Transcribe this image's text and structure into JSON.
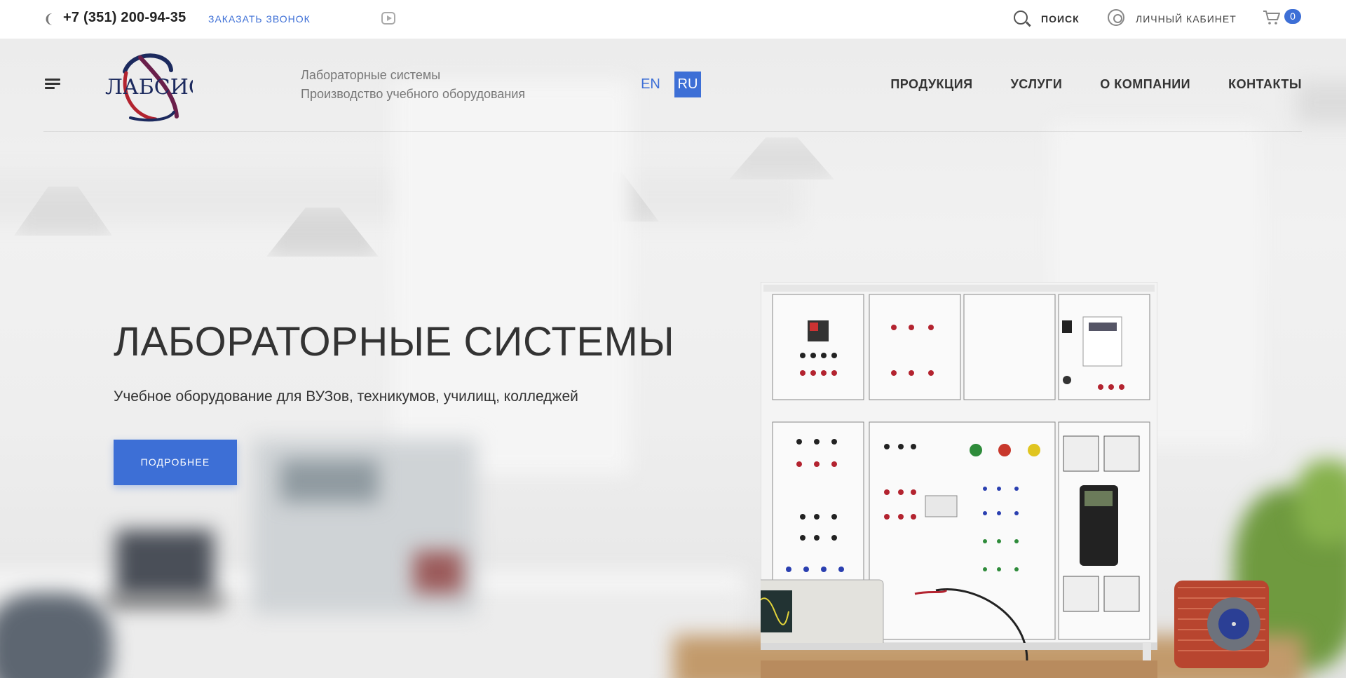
{
  "topbar": {
    "phone": "+7 (351) 200-94-35",
    "callback_label": "ЗАКАЗАТЬ ЗВОНОК",
    "search_label": "ПОИСК",
    "account_label": "ЛИЧНЫЙ КАБИНЕТ",
    "cart_count": "0"
  },
  "header": {
    "logo_text": "ЛАБСИС",
    "tagline_line1": "Лабораторные системы",
    "tagline_line2": "Производство учебного оборудования",
    "lang_en": "EN",
    "lang_ru": "RU",
    "nav": [
      "ПРОДУКЦИЯ",
      "УСЛУГИ",
      "О КОМПАНИИ",
      "КОНТАКТЫ"
    ]
  },
  "hero": {
    "title": "ЛАБОРАТОРНЫЕ СИСТЕМЫ",
    "subtitle": "Учебное оборудование для ВУЗов, техникумов, училищ, колледжей",
    "button_label": "ПОДРОБНЕЕ"
  },
  "colors": {
    "accent": "#3d6fd6",
    "logo_red": "#b3232f",
    "logo_navy": "#1c2a5e"
  },
  "icons": [
    "phone-icon",
    "youtube-icon",
    "search-icon",
    "user-icon",
    "cart-icon",
    "menu-icon"
  ]
}
